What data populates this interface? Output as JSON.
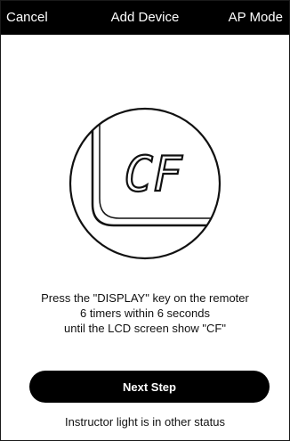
{
  "header": {
    "left_label": "Cancel",
    "title": "Add Device",
    "right_label": "AP Mode"
  },
  "illustration": {
    "display_text": "CF"
  },
  "instructions": {
    "line1": "Press the \"DISPLAY\" key on the remoter",
    "line2": "6 timers within 6 seconds",
    "line3": "until the LCD screen show \"CF\""
  },
  "next_button": {
    "label": "Next Step"
  },
  "status_link": {
    "label": "Instructor light is in other status"
  },
  "colors": {
    "header_bg": "#000000",
    "button_bg": "#000000",
    "text": "#111111"
  }
}
